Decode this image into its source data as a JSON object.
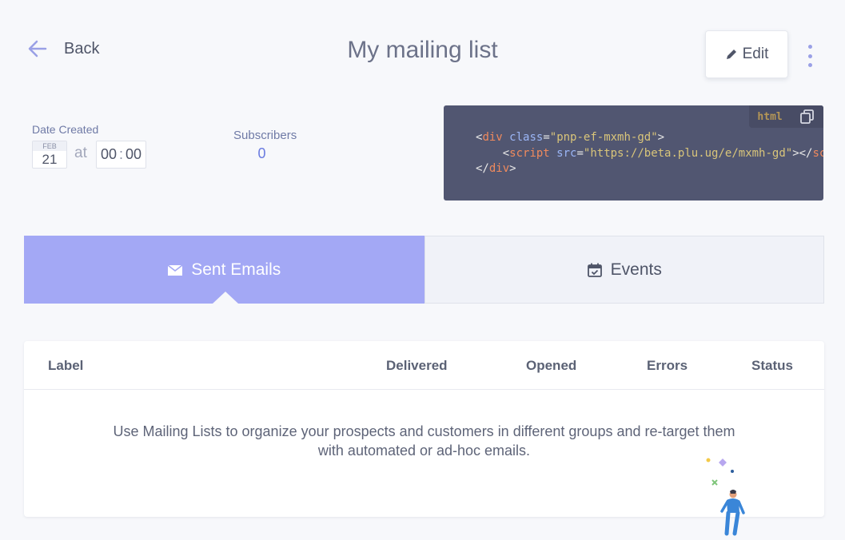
{
  "header": {
    "back_label": "Back",
    "title": "My mailing list",
    "edit_label": "Edit"
  },
  "info": {
    "date_created_label": "Date Created",
    "date_month": "FEB",
    "date_day": "21",
    "at_label": "at",
    "time_hours": "00",
    "time_minutes": "00",
    "subscribers_label": "Subscribers",
    "subscribers_value": "0"
  },
  "embed": {
    "language": "html",
    "div_tag": "div",
    "class_attr": "class",
    "class_value": "\"pnp-ef-mxmh-gd\"",
    "script_tag": "script",
    "src_attr": "src",
    "src_value": "\"https://beta.plu.ug/e/mxmh-gd\""
  },
  "tabs": [
    {
      "label": "Sent Emails",
      "icon": "envelope-icon",
      "active": true
    },
    {
      "label": "Events",
      "icon": "calendar-check-icon",
      "active": false
    }
  ],
  "table": {
    "columns": [
      "Label",
      "Delivered",
      "Opened",
      "Errors",
      "Status"
    ],
    "rows": [],
    "empty_message_line1": "Use Mailing Lists to organize your prospects and customers in different groups and re-target them",
    "empty_message_line2": "with automated or ad-hoc emails."
  },
  "colors": {
    "accent": "#a3a8f5",
    "link": "#6a7be0",
    "code_bg": "#515671"
  }
}
